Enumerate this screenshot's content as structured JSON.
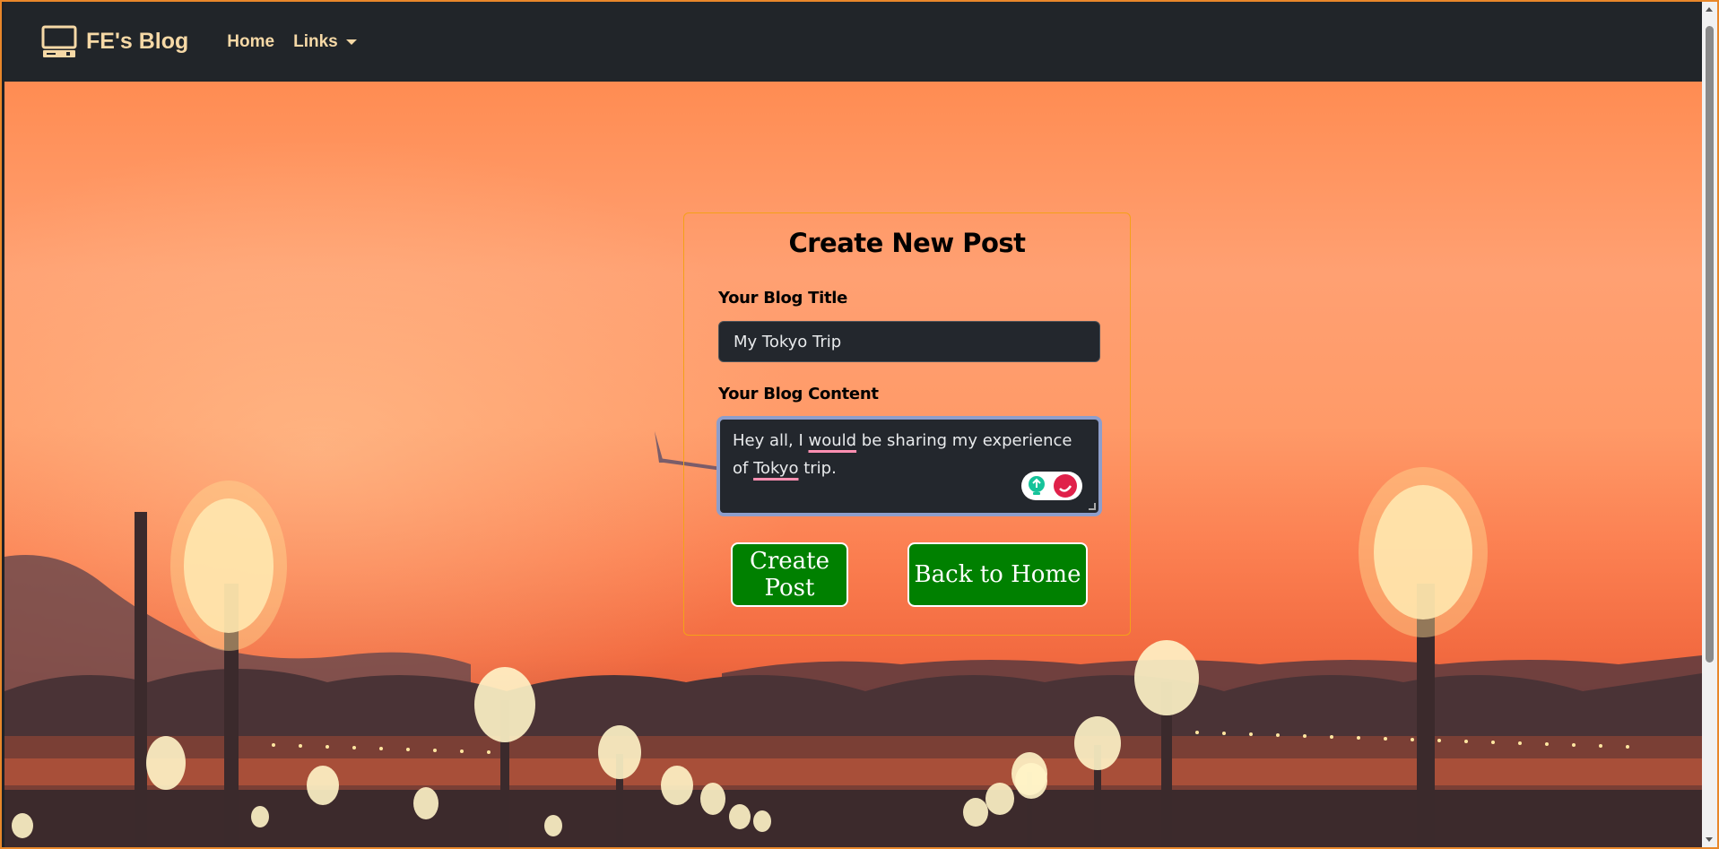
{
  "navbar": {
    "brand_icon": "computer-icon",
    "brand": "FE's Blog",
    "home": "Home",
    "links": "Links"
  },
  "form": {
    "heading": "Create New Post",
    "title_label": "Your Blog Title",
    "title_value": "My Tokyo Trip",
    "content_label": "Your Blog Content",
    "content_parts": {
      "p1": "Hey all, I ",
      "p2": "would",
      "p3": " be sharing my experience of ",
      "p4": "Tokyo",
      "p5": " trip."
    },
    "create_button": "Create Post",
    "back_button": "Back to Home"
  },
  "colors": {
    "navbar_bg": "#212529",
    "nav_text": "#f6d9a6",
    "button_bg": "#008000",
    "card_border": "#f4a019",
    "input_bg": "#23272d"
  }
}
